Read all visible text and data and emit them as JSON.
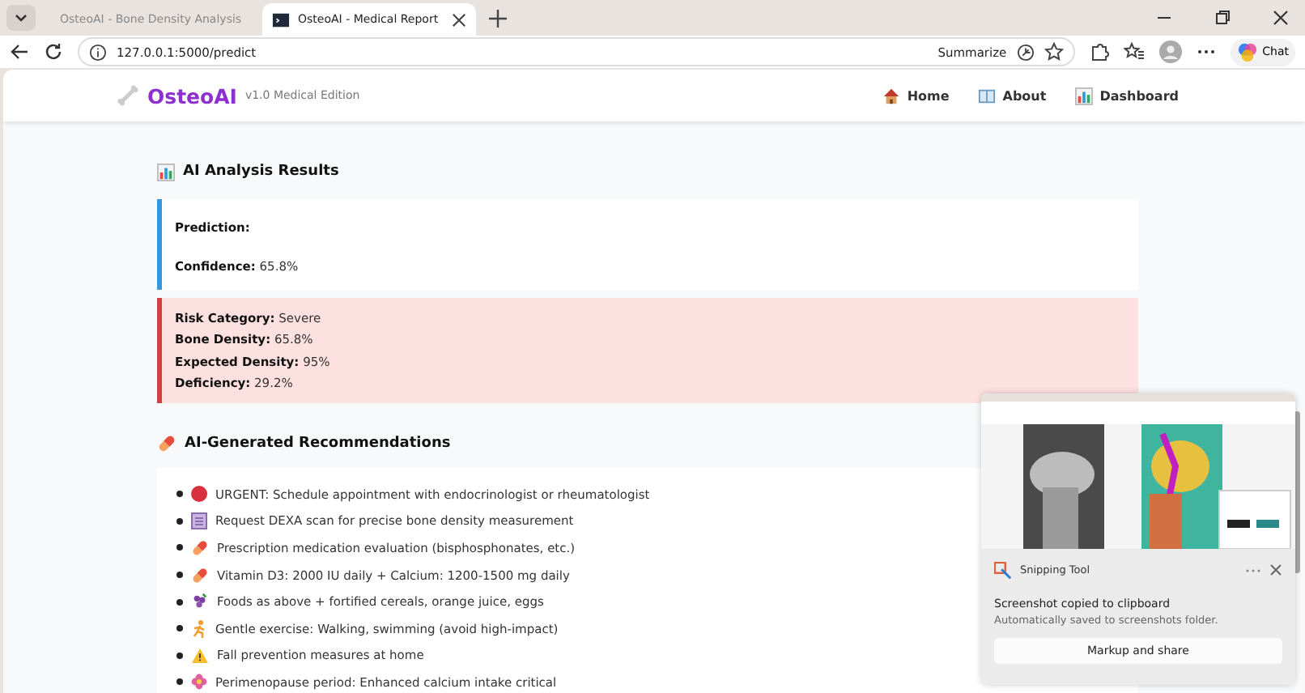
{
  "browser": {
    "tabs": [
      {
        "title": "OsteoAI - Bone Density Analysis",
        "selected": false
      },
      {
        "title": "OsteoAI - Medical Report",
        "selected": true
      }
    ],
    "address": "127.0.0.1:5000/predict",
    "summarize": "Summarize",
    "chat": "Chat"
  },
  "navbar": {
    "brand": "OsteoAI",
    "edition": "v1.0 Medical Edition",
    "links": [
      {
        "label": "Home",
        "kind": "home"
      },
      {
        "label": "About",
        "kind": "about"
      },
      {
        "label": "Dashboard",
        "kind": "dashboard"
      }
    ]
  },
  "results": {
    "title": "AI Analysis Results",
    "prediction": [
      {
        "label": "Prediction:"
      },
      {
        "label": "Confidence:",
        "value": "65.8%"
      }
    ],
    "risk": [
      {
        "label": "Risk Category:",
        "value": "Severe"
      },
      {
        "label": "Bone Density:",
        "value": "65.8%"
      },
      {
        "label": "Expected Density:",
        "value": "95%"
      },
      {
        "label": "Deficiency:",
        "value": "29.2%"
      }
    ]
  },
  "recommendations": {
    "title": "AI-Generated Recommendations",
    "items": [
      {
        "kind": "urgent",
        "text": "URGENT: Schedule appointment with endocrinologist or rheumatologist"
      },
      {
        "kind": "test",
        "text": "Request DEXA scan for precise bone density measurement"
      },
      {
        "kind": "medication",
        "text": "Prescription medication evaluation (bisphosphonates, etc.)"
      },
      {
        "kind": "medication",
        "text": "Vitamin D3: 2000 IU daily + Calcium: 1200-1500 mg daily"
      },
      {
        "kind": "diet",
        "text": "Foods as above + fortified cereals, orange juice, eggs"
      },
      {
        "kind": "exercise",
        "text": "Gentle exercise: Walking, swimming (avoid high-impact)"
      },
      {
        "kind": "warning",
        "text": "Fall prevention measures at home"
      },
      {
        "kind": "hormone",
        "text": "Perimenopause period: Enhanced calcium intake critical"
      }
    ]
  },
  "snipping_toast": {
    "app": "Snipping Tool",
    "title": "Screenshot copied to clipboard",
    "message": "Automatically saved to screenshots folder.",
    "button": "Markup and share"
  }
}
